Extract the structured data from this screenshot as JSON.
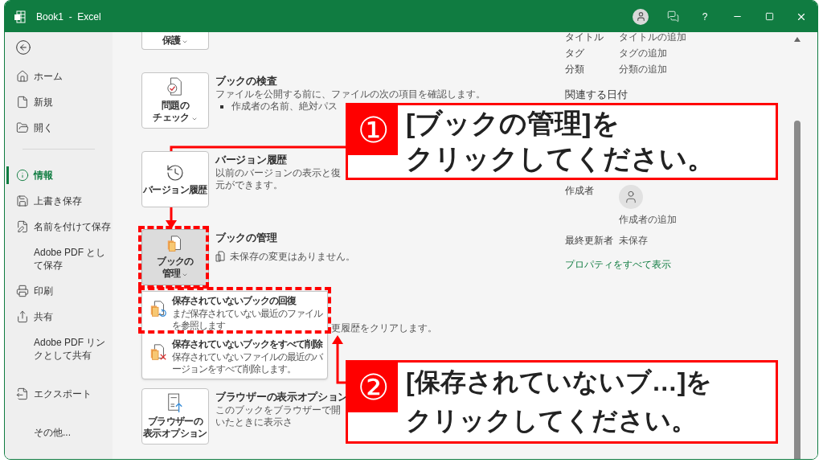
{
  "window": {
    "title": "Book1  -  Excel",
    "help": "?"
  },
  "sidebar": {
    "groups": [
      [
        {
          "label": "ホーム",
          "selected": false
        },
        {
          "label": "新規",
          "selected": false
        },
        {
          "label": "開く",
          "selected": false
        }
      ],
      [
        {
          "label": "情報",
          "selected": true
        },
        {
          "label": "上書き保存",
          "selected": false
        },
        {
          "label": "名前を付けて保存",
          "selected": false
        },
        {
          "label": "Adobe PDF として保存",
          "selected": false
        },
        {
          "label": "印刷",
          "selected": false
        },
        {
          "label": "共有",
          "selected": false
        },
        {
          "label": "Adobe PDF リンクとして共有",
          "selected": false
        }
      ],
      [
        {
          "label": "エクスポート",
          "selected": false
        }
      ],
      [
        {
          "label": "その他...",
          "selected": false
        }
      ]
    ]
  },
  "info": {
    "sections": [
      {
        "button": [
          "保護"
        ],
        "menu": true,
        "selected": false
      },
      {
        "button": [
          "問題の",
          "チェック"
        ],
        "menu": true,
        "selected": false,
        "heading": "ブックの検査",
        "description": "ファイルを公開する前に、ファイルの次の項目を確認します。",
        "bullets": [
          "作成者の名前、絶対パス"
        ]
      },
      {
        "button": [
          "バージョン履歴"
        ],
        "menu": false,
        "selected": false,
        "heading": "バージョン履歴",
        "description": "以前のバージョンの表示と復元ができます。"
      },
      {
        "button": [
          "ブックの",
          "管理"
        ],
        "menu": true,
        "selected": true,
        "heading": "ブックの管理",
        "status": "未保存の変更はありません。",
        "partial_note": "更履歴をクリアします。",
        "dropdown": [
          {
            "title": "保存されていないブックの回復",
            "description": "まだ保存されていない最近のファイルを参照します"
          },
          {
            "title": "保存されていないブックをすべて削除",
            "description": "保存されていないファイルの最近のバージョンをすべて削除します。"
          }
        ]
      },
      {
        "button": [
          "ブラウザーの",
          "表示オプション"
        ],
        "menu": false,
        "selected": false,
        "heading": "ブラウザーの表示オプション",
        "description": "このブックをブラウザーで開いたときに表示さ"
      }
    ]
  },
  "properties": {
    "fields": [
      {
        "label": "タイトル",
        "value": "タイトルの追加"
      },
      {
        "label": "タグ",
        "value": "タグの追加"
      },
      {
        "label": "分類",
        "value": "分類の追加"
      }
    ],
    "dates_heading": "関連する日付",
    "people": [
      {
        "label": "作成者",
        "add_action": "作成者の追加",
        "kind": "avatar"
      },
      {
        "label": "最終更新者",
        "value": "未保存",
        "kind": "text"
      }
    ],
    "link": "プロパティをすべて表示"
  },
  "callouts": [
    {
      "number": "①",
      "lines": [
        "[ブックの管理]を",
        "クリックしてください。"
      ]
    },
    {
      "number": "②",
      "lines": [
        "[保存されていないブ…]を",
        "クリックしてください。"
      ]
    }
  ]
}
